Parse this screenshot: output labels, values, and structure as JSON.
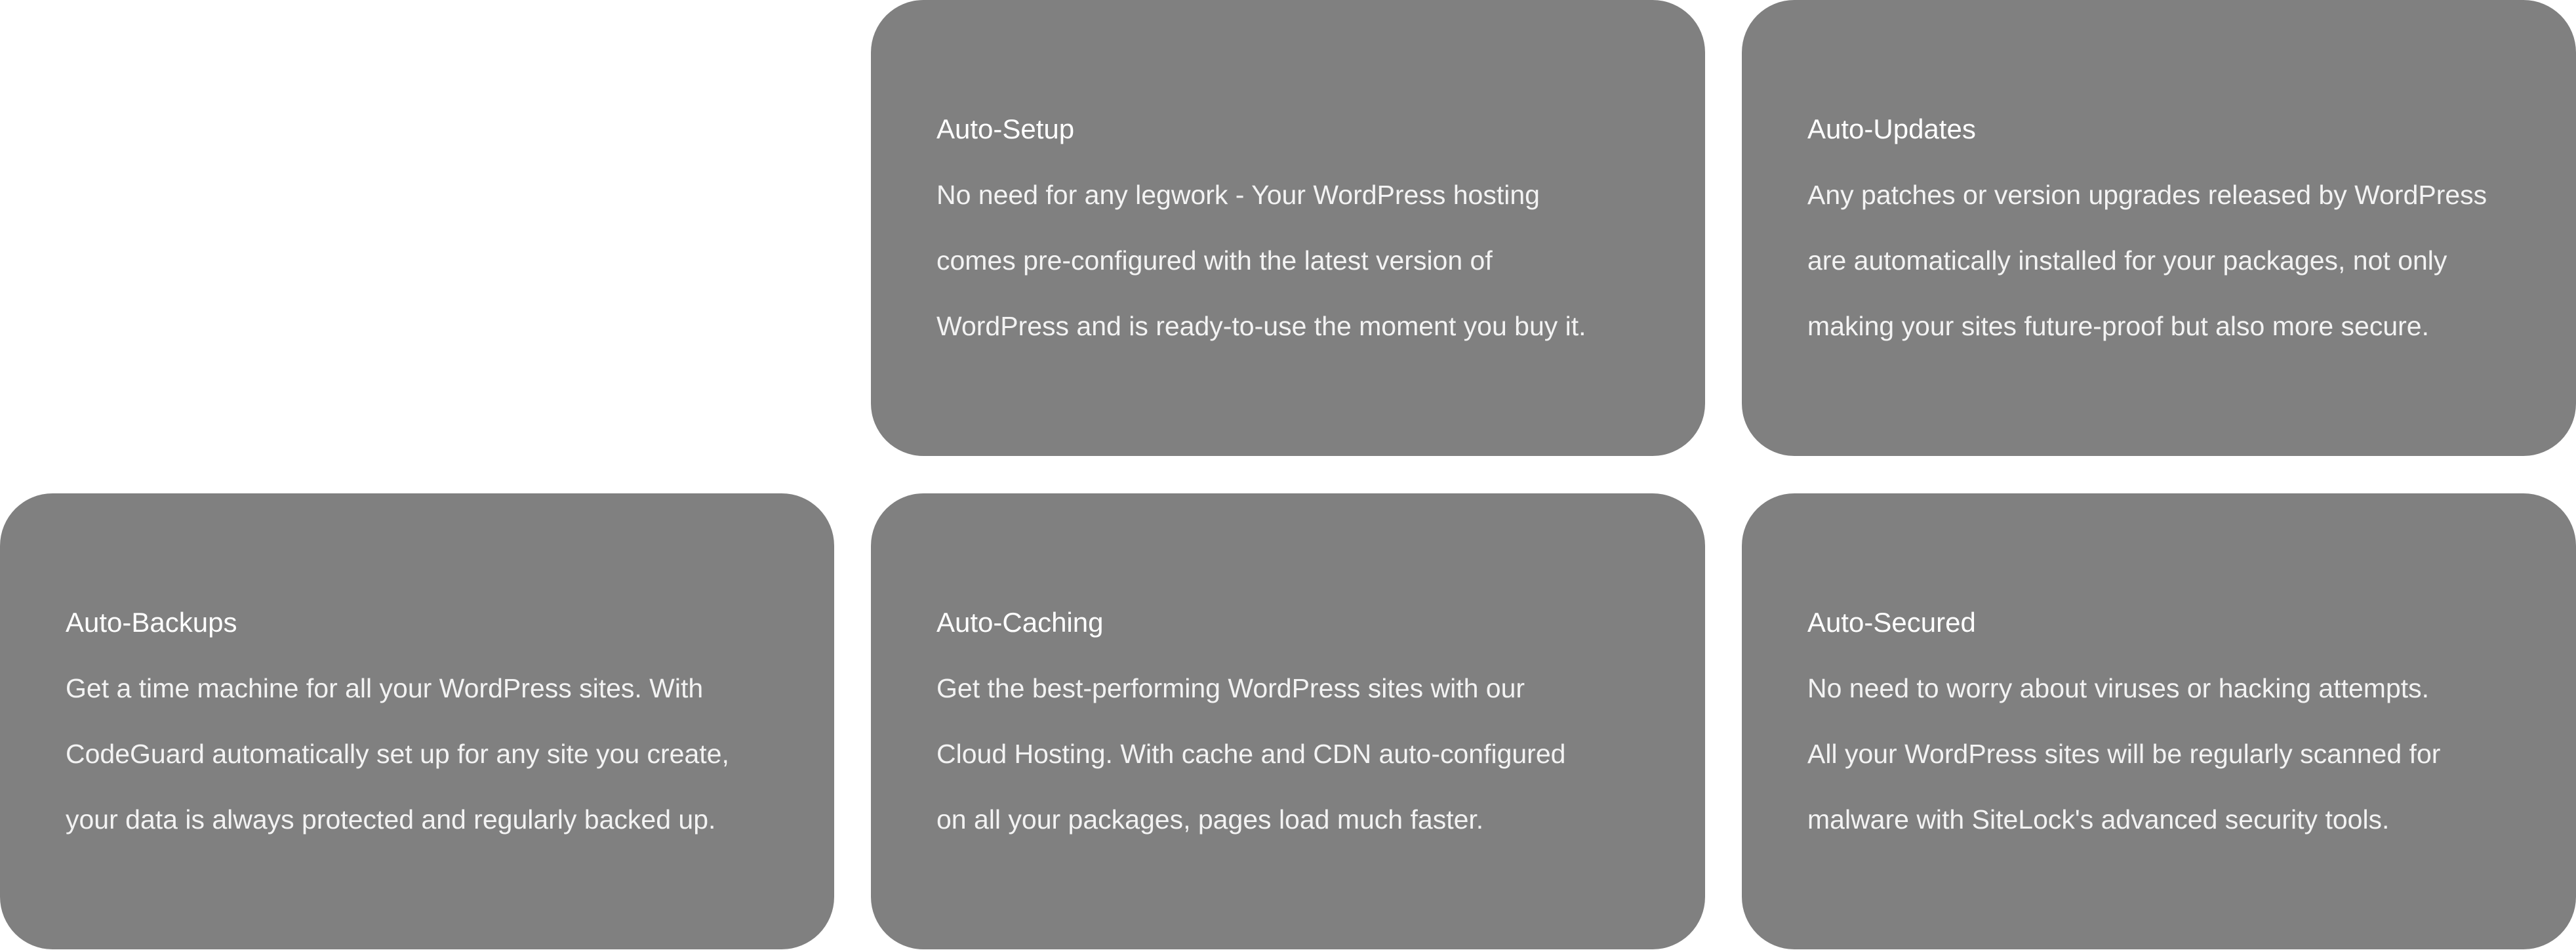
{
  "colors": {
    "page_background": "#ffffff",
    "card_background": "#808080",
    "text": "#ffffff"
  },
  "features": [
    {
      "title": "Auto-Setup",
      "lines": [
        "No need for any legwork - Your WordPress hosting",
        "comes pre-configured with the latest version of",
        "WordPress and is ready-to-use the moment you buy it."
      ]
    },
    {
      "title": "Auto-Updates",
      "lines": [
        "Any patches or version upgrades released by WordPress",
        "are automatically installed for your packages, not only",
        "making your sites future-proof but also more secure."
      ]
    },
    {
      "title": "Auto-Backups",
      "lines": [
        "Get a time machine for all your WordPress sites. With",
        "CodeGuard automatically set up for any site you create,",
        "your data is always protected and regularly backed up."
      ]
    },
    {
      "title": "Auto-Caching",
      "lines": [
        "Get the best-performing WordPress sites with our",
        "Cloud Hosting. With cache and CDN auto-configured",
        "on all your packages, pages load much faster."
      ]
    },
    {
      "title": "Auto-Secured",
      "lines": [
        "No need to worry about viruses or hacking attempts.",
        "All your WordPress sites will be regularly scanned for",
        "malware with SiteLock's advanced security tools."
      ]
    }
  ]
}
